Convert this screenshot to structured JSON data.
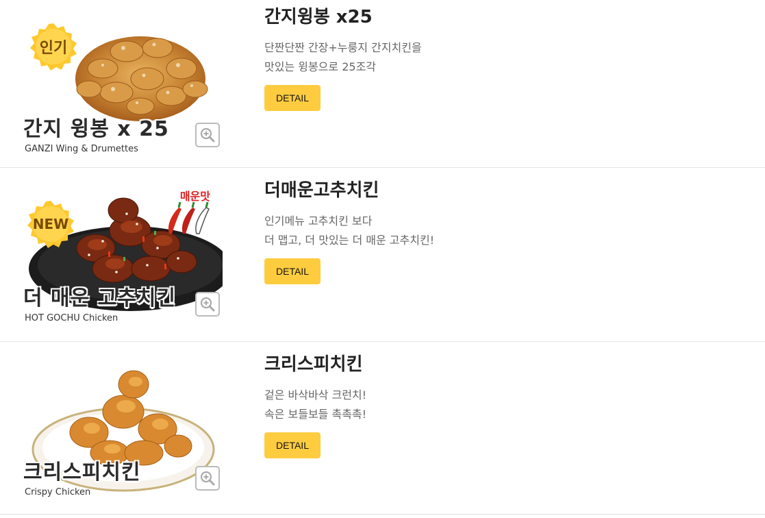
{
  "menu_items": [
    {
      "title": "간지윙봉 x25",
      "desc_line1": "단짠단짠 간장+누룽지 간지치킨을",
      "desc_line2": "맛있는 윙봉으로 25조각",
      "button": "DETAIL",
      "image": {
        "badge": "인기",
        "title": "간지 윙봉 x 25",
        "subtitle": "GANZI Wing & Drumettes"
      }
    },
    {
      "title": "더매운고추치킨",
      "desc_line1": "인기메뉴 고추치킨 보다",
      "desc_line2": "더 맵고, 더 맛있는 더 매운 고추치킨!",
      "button": "DETAIL",
      "image": {
        "badge": "NEW",
        "spicy_label": "매운맛",
        "title": "더 매운 고추치킨",
        "subtitle": "HOT GOCHU Chicken"
      }
    },
    {
      "title": "크리스피치킨",
      "desc_line1": "겉은 바삭바삭 크런치!",
      "desc_line2": "속은 보들보들 촉촉촉!",
      "button": "DETAIL",
      "image": {
        "title": "크리스피치킨",
        "subtitle": "Crispy Chicken"
      }
    }
  ],
  "colors": {
    "detail_button": "#ffcc40",
    "badge": "#ffc82e",
    "divider": "#e3e3e3",
    "spicy_text": "#e02020"
  },
  "icons": {
    "zoom": "zoom-in-icon",
    "chili": "chili-pepper-icon"
  }
}
